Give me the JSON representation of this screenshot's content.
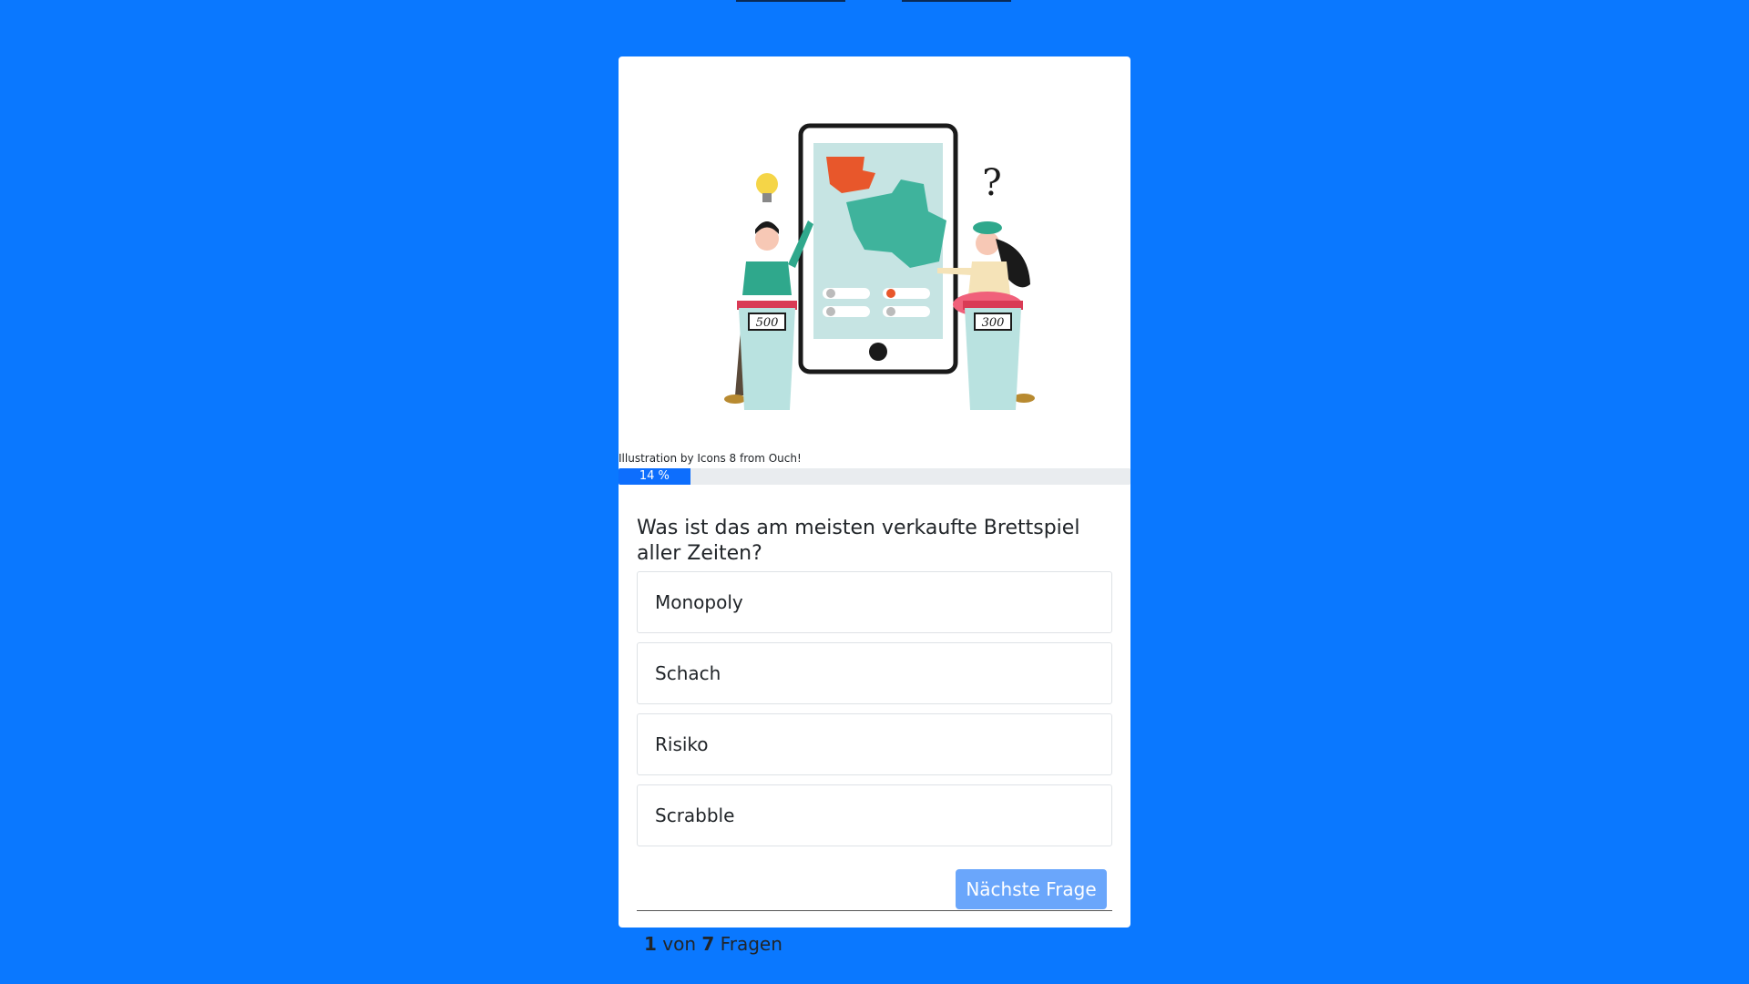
{
  "illustration": {
    "credit": "Illustration by Icons 8 from Ouch!",
    "score_left": "500",
    "score_right": "300",
    "question_mark": "?"
  },
  "progress": {
    "label": "14 %",
    "fraction": 0.14
  },
  "quiz": {
    "question": "Was ist das am meisten verkaufte Brettspiel aller Zeiten?",
    "answers": [
      "Monopoly",
      "Schach",
      "Risiko",
      "Scrabble"
    ],
    "counter": {
      "current": "1",
      "of": "von",
      "total": "7",
      "unit": "Fragen"
    },
    "next_label": "Nächste Frage"
  },
  "colors": {
    "background": "#0a78ff",
    "progress": "#0d6efd",
    "button": "#6aa6fb"
  }
}
